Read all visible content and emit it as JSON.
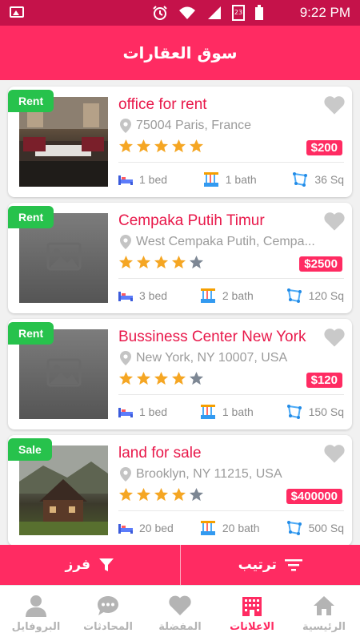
{
  "status_bar": {
    "time": "9:22 PM",
    "icons": [
      "image-icon",
      "alarm-icon",
      "wifi-icon",
      "signal-icon",
      "calendar-icon",
      "battery-icon"
    ],
    "calendar_day": "23"
  },
  "app_bar": {
    "title": "سوق العقارات"
  },
  "listings": [
    {
      "badge": "Rent",
      "title": "office for rent",
      "location": "75004 Paris, France",
      "rating": 5,
      "price": "$200",
      "beds": "1 bed",
      "baths": "1 bath",
      "area": "36 Sq",
      "image": "office-photo"
    },
    {
      "badge": "Rent",
      "title": "Cempaka Putih Timur",
      "location": "West Cempaka Putih, Cempa...",
      "rating": 4,
      "price": "$2500",
      "beds": "3 bed",
      "baths": "2 bath",
      "area": "120 Sq",
      "image": "placeholder"
    },
    {
      "badge": "Rent",
      "title": "Bussiness Center New York",
      "location": "New York, NY 10007, USA",
      "rating": 4,
      "price": "$120",
      "beds": "1 bed",
      "baths": "1 bath",
      "area": "150 Sq",
      "image": "placeholder"
    },
    {
      "badge": "Sale",
      "title": "land for sale",
      "location": "Brooklyn, NY 11215, USA",
      "rating": 4,
      "price": "$400000",
      "beds": "20 bed",
      "baths": "20 bath",
      "area": "500 Sq",
      "image": "land-photo"
    }
  ],
  "actions": {
    "sort": "ترتيب",
    "filter": "فرز"
  },
  "tabs": [
    {
      "label": "البروفايل",
      "icon": "user-icon",
      "active": false
    },
    {
      "label": "المحادثات",
      "icon": "chat-icon",
      "active": false
    },
    {
      "label": "المفضلة",
      "icon": "heart-icon",
      "active": false
    },
    {
      "label": "الاعلانات",
      "icon": "building-icon",
      "active": true
    },
    {
      "label": "الرئيسية",
      "icon": "home-icon",
      "active": false
    }
  ],
  "colors": {
    "primary": "#ff2b62",
    "status_bar": "#c5124a",
    "badge_green": "#27c24c",
    "star_orange": "#f5a623",
    "star_empty": "#7d8794"
  }
}
